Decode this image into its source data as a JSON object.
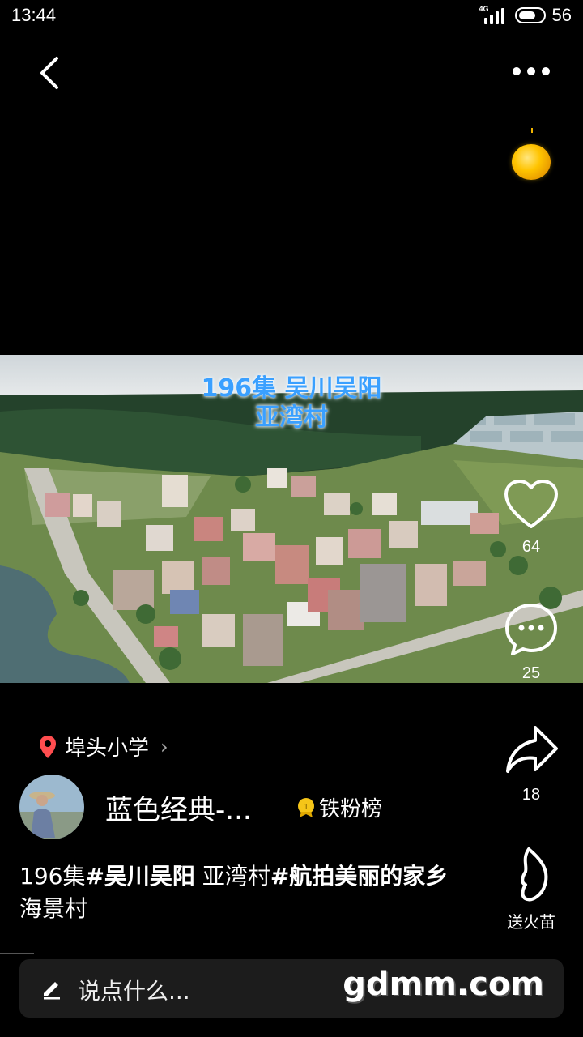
{
  "status_bar": {
    "time": "13:44",
    "network": "4G",
    "battery": "56"
  },
  "video": {
    "title_line1": "196集 吴川吴阳",
    "title_line2": "亚湾村"
  },
  "actions": {
    "like_count": "64",
    "comment_count": "25",
    "share_count": "18",
    "gift_label": "送火苗"
  },
  "location": {
    "name": "埠头小学"
  },
  "author": {
    "name": "蓝色经典-...",
    "badge_label": "铁粉榜"
  },
  "caption": {
    "part1": "196集",
    "part2": "#吴川吴阳",
    "part3": " 亚湾村",
    "part4": "#航拍美丽的家乡",
    "part5": " 海景村"
  },
  "comment_bar": {
    "placeholder": "说点什么...",
    "watermark": "gdmm.com"
  },
  "colors": {
    "pin": "#ff4d4f",
    "coin": "#ffc400",
    "badge": "#f5c518",
    "title": "#3aa0ff"
  }
}
